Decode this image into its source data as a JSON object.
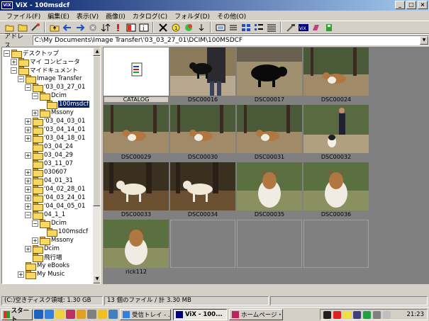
{
  "window": {
    "app_icon": "ViX",
    "title": "ViX - 100msdcf"
  },
  "menu": [
    "ファイル(F)",
    "編集(E)",
    "表示(V)",
    "画像(I)",
    "カタログ(C)",
    "フォルダ(D)",
    "その他(O)"
  ],
  "toolbar_icons": [
    "folder-open-icon",
    "folder-icon",
    "magic-icon",
    "folder-up-icon",
    "back-icon",
    "forward-icon",
    "stop-icon",
    "sort-icon",
    "alert-icon",
    "slideshow-icon",
    "info-icon",
    "delete-icon",
    "help-icon",
    "color-icon",
    "down-arrow-icon",
    "view-icon",
    "list-icon",
    "large-icons-icon",
    "small-icons-icon",
    "details-icon",
    "tools-icon",
    "vix-icon",
    "edit-icon",
    "save-icon"
  ],
  "address": {
    "label": "アドレス",
    "value": "C:\\My Documents\\Image Transfer\\'03_03_27_01\\DCIM\\100MSDCF"
  },
  "tree": [
    {
      "label": "デスクトップ",
      "level": 0,
      "expander": "-",
      "icon": "desktop-icon"
    },
    {
      "label": "マイ コンピュータ",
      "level": 1,
      "expander": "+",
      "icon": "computer-icon"
    },
    {
      "label": "マイドキュメント",
      "level": 1,
      "expander": "-",
      "icon": "folder-icon"
    },
    {
      "label": "Image Transfer",
      "level": 2,
      "expander": "-",
      "icon": "folder-icon"
    },
    {
      "label": "'03_03_27_01",
      "level": 3,
      "expander": "-",
      "icon": "folder-icon"
    },
    {
      "label": "Dcim",
      "level": 4,
      "expander": "-",
      "icon": "folder-icon"
    },
    {
      "label": "100msdcf",
      "level": 5,
      "expander": "",
      "icon": "folder-open-icon",
      "selected": true
    },
    {
      "label": "Mssony",
      "level": 4,
      "expander": "+",
      "icon": "folder-icon"
    },
    {
      "label": "'03_04_03_01",
      "level": 3,
      "expander": "+",
      "icon": "folder-icon"
    },
    {
      "label": "'03_04_14_01",
      "level": 3,
      "expander": "+",
      "icon": "folder-icon"
    },
    {
      "label": "'03_04_18_01",
      "level": 3,
      "expander": "+",
      "icon": "folder-icon"
    },
    {
      "label": "03_04_24",
      "level": 3,
      "expander": "",
      "icon": "folder-icon"
    },
    {
      "label": "03_04_29",
      "level": 3,
      "expander": "+",
      "icon": "folder-icon"
    },
    {
      "label": "03_11_07",
      "level": 3,
      "expander": "",
      "icon": "folder-icon"
    },
    {
      "label": "030607",
      "level": 3,
      "expander": "+",
      "icon": "folder-icon"
    },
    {
      "label": "04_01_31",
      "level": 3,
      "expander": "+",
      "icon": "folder-icon"
    },
    {
      "label": "'04_02_28_01",
      "level": 3,
      "expander": "+",
      "icon": "folder-icon"
    },
    {
      "label": "'04_03_24_01",
      "level": 3,
      "expander": "+",
      "icon": "folder-icon"
    },
    {
      "label": "'04_04_05_01",
      "level": 3,
      "expander": "+",
      "icon": "folder-icon"
    },
    {
      "label": "04_1_1",
      "level": 3,
      "expander": "-",
      "icon": "folder-icon"
    },
    {
      "label": "Dcim",
      "level": 4,
      "expander": "-",
      "icon": "folder-icon"
    },
    {
      "label": "100msdcf",
      "level": 5,
      "expander": "",
      "icon": "folder-icon"
    },
    {
      "label": "Mssony",
      "level": 4,
      "expander": "+",
      "icon": "folder-icon"
    },
    {
      "label": "Dcim",
      "level": 3,
      "expander": "+",
      "icon": "folder-icon"
    },
    {
      "label": "飛行場",
      "level": 3,
      "expander": "",
      "icon": "folder-icon"
    },
    {
      "label": "My eBooks",
      "level": 2,
      "expander": "",
      "icon": "folder-icon"
    },
    {
      "label": "My Music",
      "level": 2,
      "expander": "+",
      "icon": "folder-icon"
    }
  ],
  "thumbnails": [
    {
      "name": "CATALOG",
      "kind": "catalog"
    },
    {
      "name": "DSC00016",
      "kind": "dog-walk"
    },
    {
      "name": "DSC00017",
      "kind": "black-dog"
    },
    {
      "name": "DSC00024",
      "kind": "collie-forest"
    },
    {
      "name": "DSC00029",
      "kind": "collie-forest"
    },
    {
      "name": "DSC00030",
      "kind": "collie-forest"
    },
    {
      "name": "DSC00031",
      "kind": "collie-forest"
    },
    {
      "name": "DSC00032",
      "kind": "person-dog"
    },
    {
      "name": "DSC00033",
      "kind": "white-dog"
    },
    {
      "name": "DSC00034",
      "kind": "white-dog"
    },
    {
      "name": "DSC00035",
      "kind": "collie-portrait"
    },
    {
      "name": "DSC00036",
      "kind": "collie-portrait"
    },
    {
      "name": "rick112",
      "kind": "collie-portrait"
    },
    {
      "name": "",
      "kind": "empty"
    },
    {
      "name": "",
      "kind": "empty"
    },
    {
      "name": "",
      "kind": "empty"
    }
  ],
  "status": {
    "disk": "(C:)空きディスク領域: 1.30 GB",
    "files": "13 個のファイル / 計 3.30 MB",
    "extra": ""
  },
  "taskbar": {
    "start_label": "スタート",
    "tasks": [
      {
        "label": "受信トレイ - ...",
        "active": false
      },
      {
        "label": "ViX - 100...",
        "active": true
      },
      {
        "label": "ホームページ・...",
        "active": false
      }
    ],
    "clock": "21:23"
  },
  "colors": {
    "titlebar_start": "#0a246a",
    "titlebar_end": "#a6caf0",
    "face": "#d4d0c8",
    "selection": "#0a246a"
  }
}
